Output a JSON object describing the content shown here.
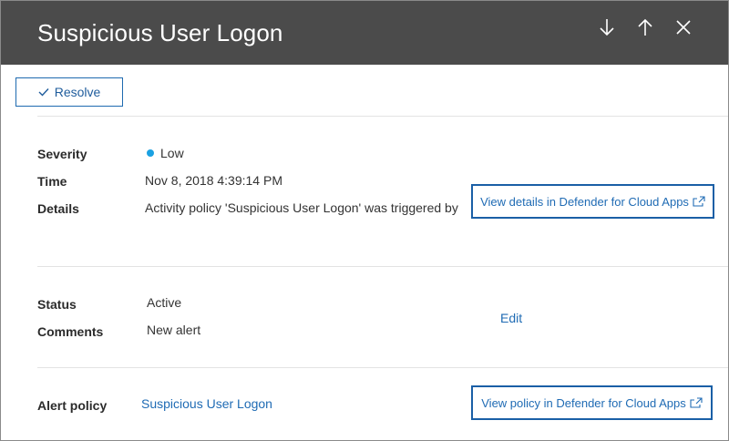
{
  "header": {
    "title": "Suspicious User Logon",
    "icons": [
      "arrow-down-icon",
      "arrow-up-icon",
      "close-icon"
    ]
  },
  "toolbar": {
    "resolve_label": "Resolve"
  },
  "details": {
    "severity_label": "Severity",
    "severity_value": "Low",
    "severity_color": "#1ba1e2",
    "time_label": "Time",
    "time_value": "Nov 8, 2018 4:39:14 PM",
    "details_label": "Details",
    "details_value": "Activity policy 'Suspicious User Logon' was triggered by",
    "view_details_link": "View details in Defender for Cloud Apps"
  },
  "status_section": {
    "status_label": "Status",
    "status_value": "Active",
    "comments_label": "Comments",
    "comments_value": "New alert",
    "edit_label": "Edit"
  },
  "policy_section": {
    "alert_policy_label": "Alert policy",
    "alert_policy_value": "Suspicious User Logon",
    "view_policy_link": "View policy in Defender for Cloud Apps"
  },
  "colors": {
    "header_bg": "#4b4b4b",
    "link": "#1f6bb4",
    "highlight_border": "#1a5fa6"
  }
}
